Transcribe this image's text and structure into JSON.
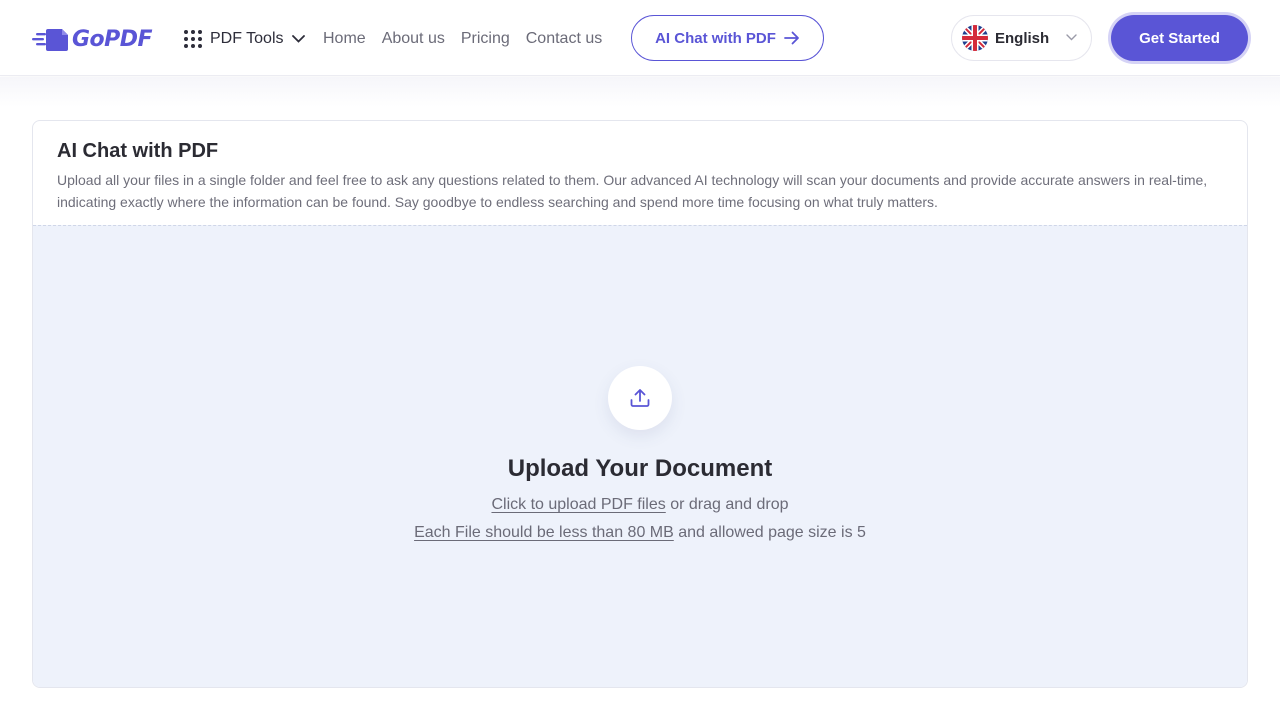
{
  "header": {
    "logo_text": "GoPDF",
    "pdf_tools_label": "PDF Tools",
    "nav": [
      "Home",
      "About us",
      "Pricing",
      "Contact us"
    ],
    "ai_chat_button": "AI Chat with PDF",
    "language": "English",
    "get_started": "Get Started"
  },
  "card": {
    "title": "AI Chat with PDF",
    "description": "Upload all your files in a single folder and feel free to ask any questions related to them. Our advanced AI technology will scan your documents and provide accurate answers in real-time, indicating exactly where the information can be found. Say goodbye to endless searching and spend more time focusing on what truly matters."
  },
  "upload": {
    "title": "Upload Your Document",
    "click_link": "Click to upload PDF files",
    "drag_text": " or drag and drop",
    "size_link": "Each File should be less than 80 MB",
    "page_text": " and allowed page size is 5"
  },
  "colors": {
    "accent": "#5a55d6",
    "dropzone_bg": "#eef2fb"
  },
  "icons": [
    "logo-speed-lines-icon",
    "grid-dots-icon",
    "chevron-down-icon",
    "arrow-right-icon",
    "uk-flag-icon",
    "upload-icon"
  ]
}
